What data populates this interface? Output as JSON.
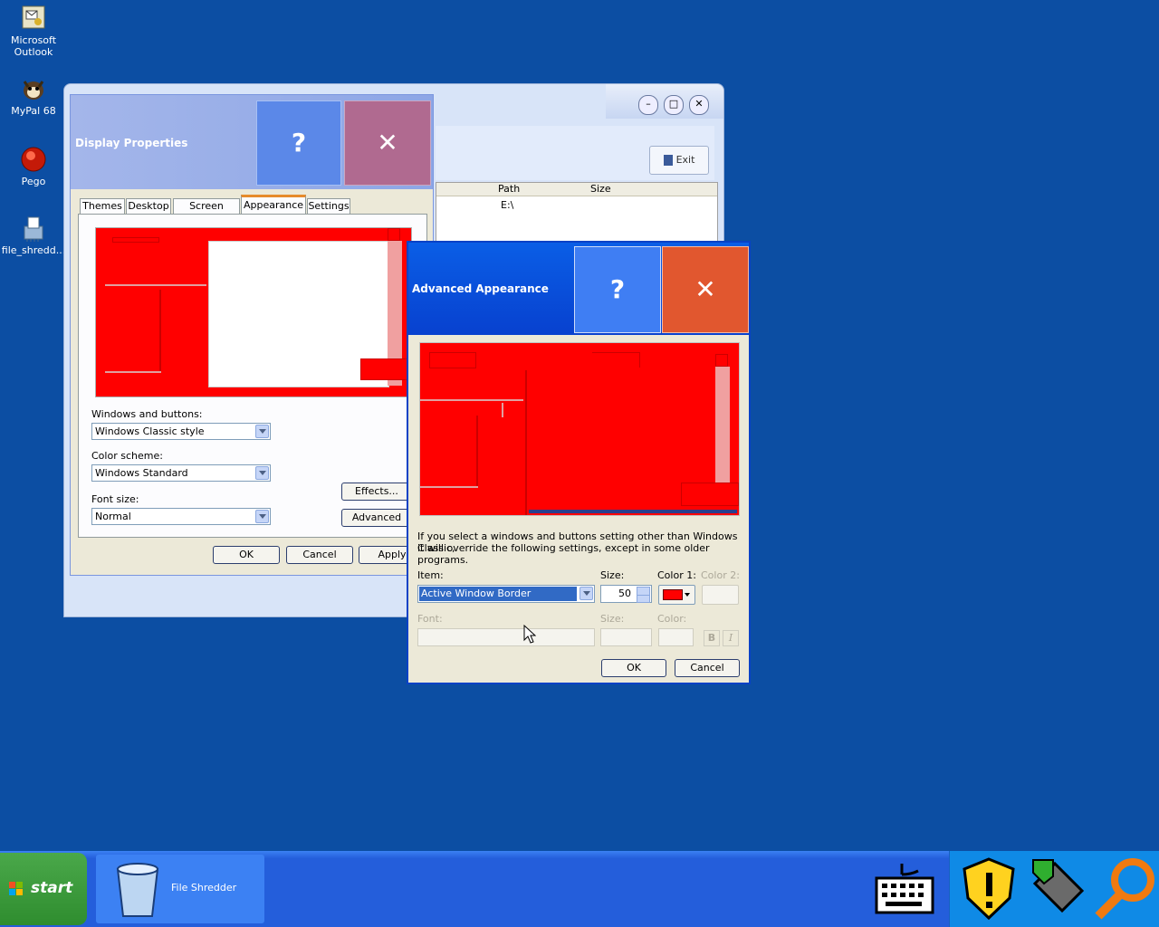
{
  "desktop_icons": [
    {
      "label": "Microsoft Outlook",
      "icon": "outlook-icon"
    },
    {
      "label": "MyPal 68",
      "icon": "mypal-icon"
    },
    {
      "label": "Pego",
      "icon": "pego-icon"
    },
    {
      "label": "file_shredd...",
      "icon": "file-shredder-icon"
    }
  ],
  "back_window": {
    "exit_label": "Exit",
    "columns": [
      "Path",
      "Size"
    ],
    "row_path": "E:\\"
  },
  "display_properties": {
    "title": "Display Properties",
    "help": "?",
    "close": "✕",
    "tabs": [
      "Themes",
      "Desktop",
      "Screen Saver",
      "Appearance",
      "Settings"
    ],
    "active_tab": "Appearance",
    "windows_buttons_label": "Windows and buttons:",
    "windows_buttons_value": "Windows Classic style",
    "color_scheme_label": "Color scheme:",
    "color_scheme_value": "Windows Standard",
    "font_size_label": "Font size:",
    "font_size_value": "Normal",
    "effects_button": "Effects...",
    "advanced_button": "Advanced",
    "ok": "OK",
    "cancel": "Cancel",
    "apply": "Apply"
  },
  "advanced_appearance": {
    "title": "Advanced Appearance",
    "help": "?",
    "close": "✕",
    "info_text_line1": "If you select a windows and buttons setting other than Windows Classic,",
    "info_text_line2": "it will override the following settings, except in some older programs.",
    "item_label": "Item:",
    "item_value": "Active Window Border",
    "size_label": "Size:",
    "size_value": "50",
    "color1_label": "Color 1:",
    "color2_label": "Color 2:",
    "font_label": "Font:",
    "font_size_label": "Size:",
    "font_color_label": "Color:",
    "bold": "B",
    "italic": "I",
    "ok": "OK",
    "cancel": "Cancel",
    "color1_swatch": "#ff0000"
  },
  "taskbar": {
    "start_label": "start",
    "task_label": "File Shredder"
  },
  "colors": {
    "desktop": "#0c4ea3",
    "preview_red": "#ff0000",
    "selection": "#316ac5"
  }
}
